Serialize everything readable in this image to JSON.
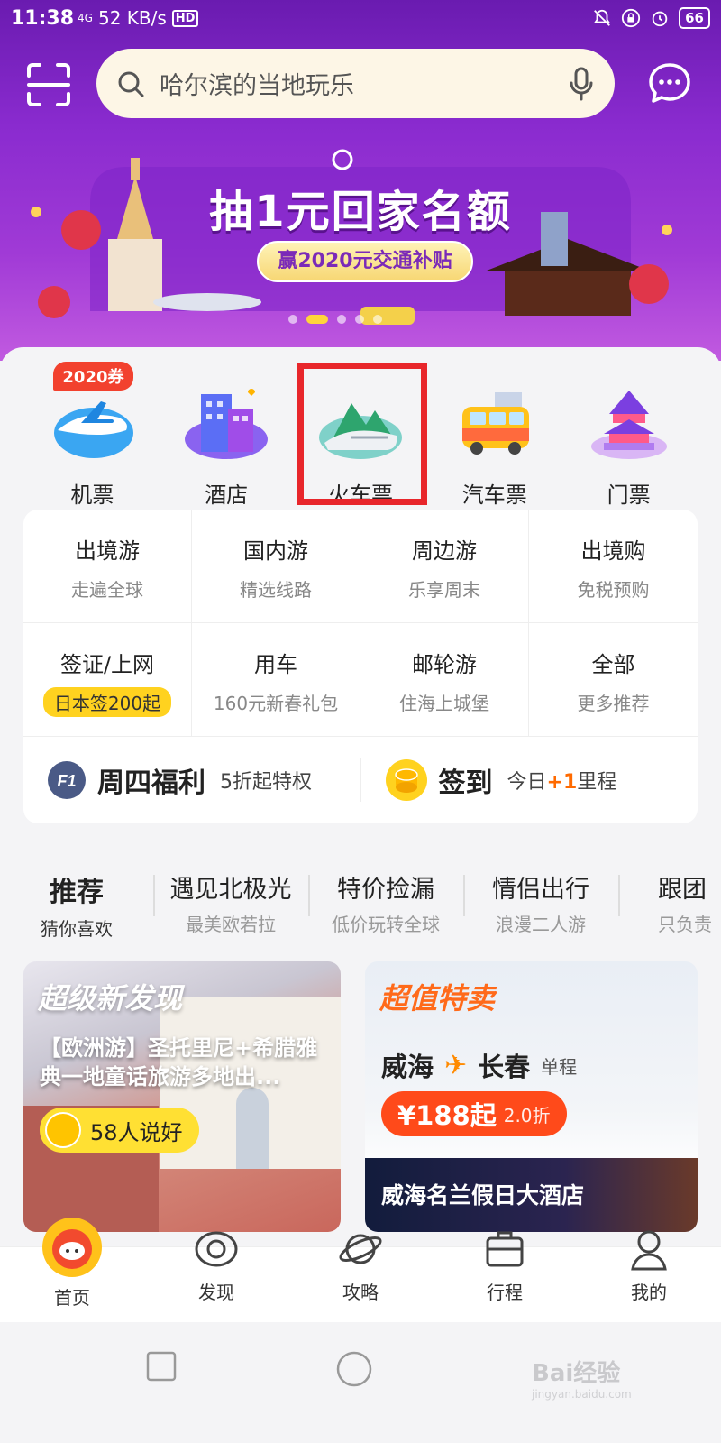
{
  "status_bar": {
    "time": "11:38",
    "network": "4G",
    "speed": "52 KB/s",
    "hd": "HD",
    "battery": "66"
  },
  "search": {
    "placeholder": "哈尔滨的当地玩乐"
  },
  "banner": {
    "title": "抽1元回家名额",
    "subtitle": "赢2020元交通补贴"
  },
  "categories": [
    {
      "label": "机票",
      "badge": "2020券"
    },
    {
      "label": "酒店"
    },
    {
      "label": "火车票"
    },
    {
      "label": "汽车票"
    },
    {
      "label": "门票"
    }
  ],
  "services": [
    {
      "title": "出境游",
      "sub": "走遍全球"
    },
    {
      "title": "国内游",
      "sub": "精选线路"
    },
    {
      "title": "周边游",
      "sub": "乐享周末"
    },
    {
      "title": "出境购",
      "sub": "免税预购"
    },
    {
      "title": "签证/上网",
      "sub": "日本签200起"
    },
    {
      "title": "用车",
      "sub": "160元新春礼包"
    },
    {
      "title": "邮轮游",
      "sub": "住海上城堡"
    },
    {
      "title": "全部",
      "sub": "更多推荐"
    }
  ],
  "promos": {
    "left": {
      "icon_text": "F1",
      "title": "周四福利",
      "desc": "5折起特权"
    },
    "right": {
      "title": "签到",
      "desc_prefix": "今日",
      "desc_plus": "+1",
      "desc_suffix": "里程"
    }
  },
  "tabs": [
    {
      "title": "推荐",
      "sub": "猜你喜欢"
    },
    {
      "title": "遇见北极光",
      "sub": "最美欧若拉"
    },
    {
      "title": "特价捡漏",
      "sub": "低价玩转全球"
    },
    {
      "title": "情侣出行",
      "sub": "浪漫二人游"
    },
    {
      "title": "跟团",
      "sub": "只负责"
    }
  ],
  "feed": {
    "left": {
      "tag": "超级新发现",
      "text": "【欧洲游】圣托里尼+希腊雅典一地童话旅游多地出...",
      "likes": "58人说好"
    },
    "right": {
      "tag": "超值特卖",
      "from": "威海",
      "to": "长春",
      "trip_type": "单程",
      "price": "¥188起",
      "discount": "2.0折",
      "hotel": "威海名兰假日大酒店"
    }
  },
  "bottom_nav": [
    {
      "label": "首页"
    },
    {
      "label": "发现"
    },
    {
      "label": "攻略"
    },
    {
      "label": "行程"
    },
    {
      "label": "我的"
    }
  ],
  "watermark": {
    "main": "Bai经验",
    "sub": "jingyan.baidu.com"
  },
  "colors": {
    "purple": "#8a2bcf",
    "yellow": "#ffe033",
    "orange": "#ff6a1a",
    "highlight_red": "#e8262b"
  }
}
